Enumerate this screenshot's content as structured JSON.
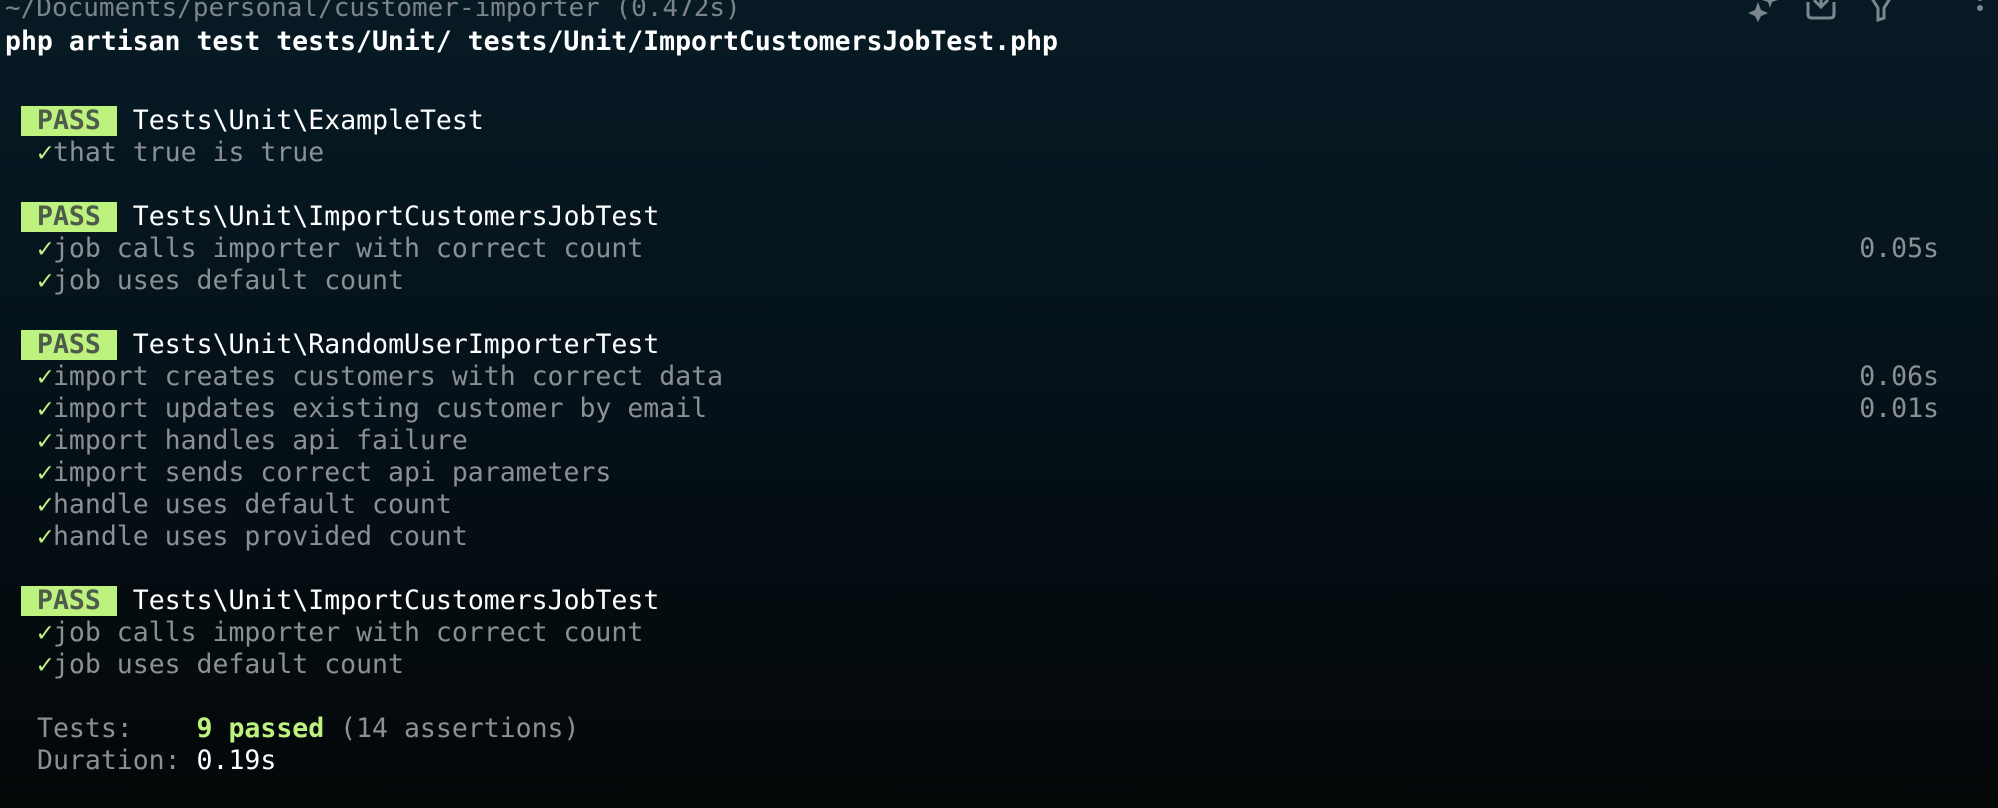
{
  "header": {
    "path": "~/Documents/personal/customer-importer (0.472s)",
    "command": "php artisan test tests/Unit/ tests/Unit/ImportCustomersJobTest.php",
    "icons": [
      "sparkle-icon",
      "download-icon",
      "filter-icon",
      "more-vertical-icon"
    ]
  },
  "suites": [
    {
      "badge": "PASS",
      "name": "Tests\\Unit\\ExampleTest",
      "tests": [
        {
          "check": "✓",
          "label": "that true is true",
          "time": ""
        }
      ]
    },
    {
      "badge": "PASS",
      "name": "Tests\\Unit\\ImportCustomersJobTest",
      "tests": [
        {
          "check": "✓",
          "label": "job calls importer with correct count",
          "time": "0.05s"
        },
        {
          "check": "✓",
          "label": "job uses default count",
          "time": ""
        }
      ]
    },
    {
      "badge": "PASS",
      "name": "Tests\\Unit\\RandomUserImporterTest",
      "tests": [
        {
          "check": "✓",
          "label": "import creates customers with correct data",
          "time": "0.06s"
        },
        {
          "check": "✓",
          "label": "import updates existing customer by email",
          "time": "0.01s"
        },
        {
          "check": "✓",
          "label": "import handles api failure",
          "time": ""
        },
        {
          "check": "✓",
          "label": "import sends correct api parameters",
          "time": ""
        },
        {
          "check": "✓",
          "label": "handle uses default count",
          "time": ""
        },
        {
          "check": "✓",
          "label": "handle uses provided count",
          "time": ""
        }
      ]
    },
    {
      "badge": "PASS",
      "name": "Tests\\Unit\\ImportCustomersJobTest",
      "tests": [
        {
          "check": "✓",
          "label": "job calls importer with correct count",
          "time": ""
        },
        {
          "check": "✓",
          "label": "job uses default count",
          "time": ""
        }
      ]
    }
  ],
  "summary": {
    "tests_label": "Tests:    ",
    "passed": "9 passed",
    "assertions": " (14 assertions)",
    "duration_label": "Duration: ",
    "duration": "0.19s"
  },
  "colors": {
    "pass": "#bdf27f",
    "background": "#071a24",
    "muted": "#8b9095"
  }
}
